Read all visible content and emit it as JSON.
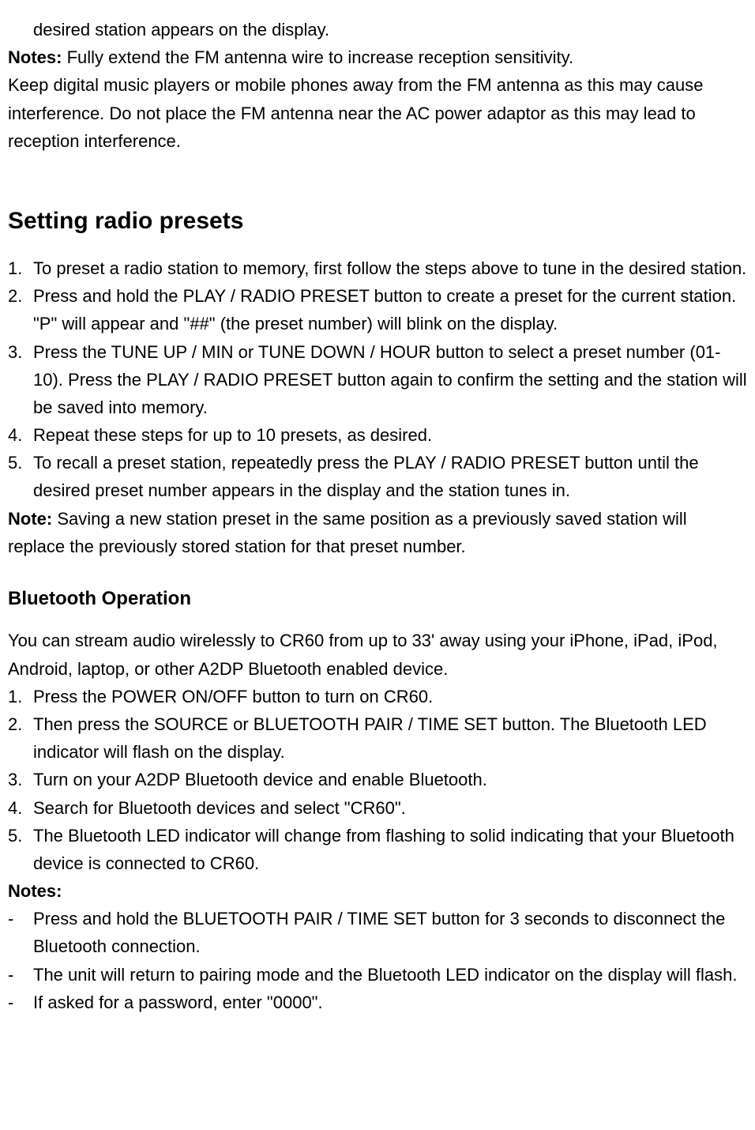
{
  "intro": {
    "line1": "desired station appears on the display.",
    "notes_label": "Notes:",
    "notes_text": " Fully extend the FM antenna wire to increase reception sensitivity.",
    "para2": "Keep digital music players or mobile phones away from the FM antenna as this may cause interference. Do not place the FM antenna near the AC power adaptor as this may lead to reception interference."
  },
  "presets": {
    "heading": "Setting radio presets",
    "items": [
      {
        "num": "1.",
        "text": "To preset a radio station to memory, first follow the steps above to tune in the desired station."
      },
      {
        "num": "2.",
        "text": "Press and hold the PLAY / RADIO PRESET button to create a preset for the current station.    \"P\" will appear and \"##\" (the preset number) will blink on the display."
      },
      {
        "num": "3.",
        "text": "Press the TUNE UP / MIN or TUNE DOWN / HOUR button to select a preset number (01- 10). Press the PLAY / RADIO PRESET button again to confirm the setting and the station will be saved into memory."
      },
      {
        "num": "4.",
        "text": "Repeat these steps for up to 10 presets, as desired."
      },
      {
        "num": "5.",
        "text": "To recall a preset station, repeatedly press the PLAY / RADIO PRESET button until the desired preset number appears in the display and the station tunes in."
      }
    ],
    "note_label": "Note:",
    "note_text": " Saving a new station preset in the same position as a previously saved station will replace the previously stored station for that preset number."
  },
  "bluetooth": {
    "heading": "Bluetooth Operation",
    "intro": "You can stream audio wirelessly to CR60 from up to 33' away using your iPhone, iPad, iPod, Android, laptop, or other A2DP Bluetooth enabled device.",
    "items": [
      {
        "num": "1.",
        "text": "Press the POWER ON/OFF button to turn on CR60."
      },
      {
        "num": "2.",
        "text": "Then press the SOURCE or BLUETOOTH PAIR / TIME SET button.    The Bluetooth LED indicator will flash on the display."
      },
      {
        "num": "3.",
        "text": "Turn on your A2DP Bluetooth device and enable Bluetooth."
      },
      {
        "num": "4.",
        "text": "Search for Bluetooth devices and select \"CR60\"."
      },
      {
        "num": "5.",
        "text": "The Bluetooth LED indicator will change from flashing to solid indicating that your Bluetooth device is connected to CR60."
      }
    ],
    "notes_label": "Notes:",
    "notes": [
      {
        "dash": "-",
        "text": "Press and hold the BLUETOOTH PAIR / TIME SET button for 3 seconds to disconnect the Bluetooth connection."
      },
      {
        "dash": "-",
        "text": "The unit will return to pairing mode and the Bluetooth LED indicator on the display will flash."
      },
      {
        "dash": "-",
        "text": "If asked for a password, enter \"0000\"."
      }
    ]
  }
}
